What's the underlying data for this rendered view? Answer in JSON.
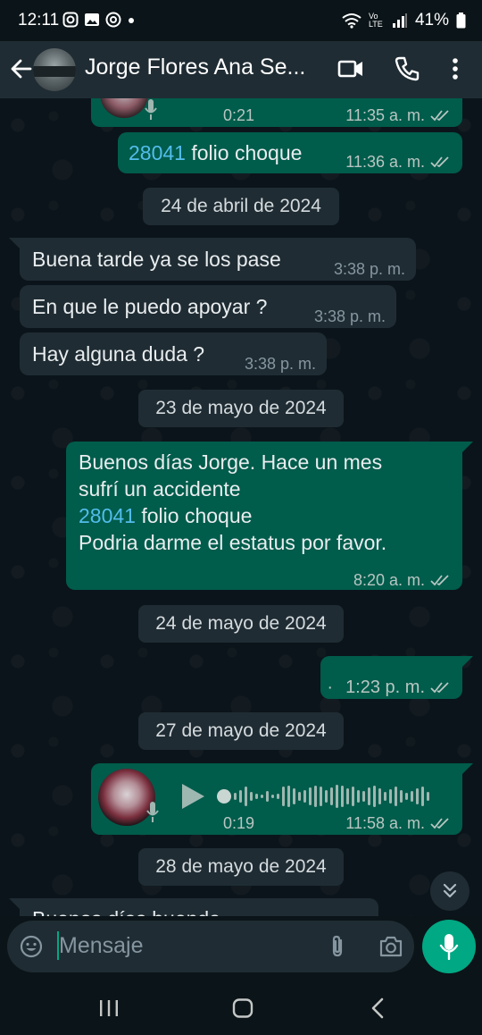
{
  "status_bar": {
    "time": "12:11",
    "battery": "41%",
    "network_label": "Vo LTE",
    "icons": [
      "instagram-icon",
      "gallery-icon",
      "threads-icon",
      "dot-icon",
      "wifi-icon",
      "signal-icon",
      "battery-icon"
    ]
  },
  "header": {
    "title": "Jorge Flores Ana Se...",
    "icons": [
      "back-arrow-icon",
      "video-call-icon",
      "phone-call-icon",
      "more-vert-icon"
    ]
  },
  "messages": {
    "voice_top": {
      "duration": "0:21",
      "time": "11:35 a. m."
    },
    "m1": {
      "link": "28041",
      "text": " folio choque",
      "time": "11:36 a. m."
    },
    "date1": "24 de abril de 2024",
    "m2": {
      "text": "Buena tarde ya se los pase",
      "time": "3:38 p. m."
    },
    "m3": {
      "text": "En que le puedo apoyar ?",
      "time": "3:38 p. m."
    },
    "m4": {
      "text": "Hay alguna duda ?",
      "time": "3:38 p. m."
    },
    "date2": "23 de mayo de 2024",
    "m5": {
      "line1": "Buenos días Jorge. Hace un mes",
      "line2": "sufrí un accidente",
      "link": "28041",
      "line3_rest": " folio choque",
      "line4": "Podria darme el estatus por favor.",
      "time": "8:20 a. m."
    },
    "date3": "24 de mayo de 2024",
    "m6": {
      "text": "·",
      "time": "1:23 p. m."
    },
    "date4": "27 de mayo de 2024",
    "voice": {
      "duration": "0:19",
      "time": "11:58 a. m."
    },
    "date5": "28 de mayo de 2024",
    "partial": "Buenos días buenda..."
  },
  "input": {
    "placeholder": "Mensaje"
  },
  "nav": {
    "icons": [
      "recent-apps-icon",
      "home-icon",
      "back-nav-icon"
    ]
  },
  "colors": {
    "outgoing": "#005c4b",
    "incoming": "#1f2c33",
    "link": "#53bdeb",
    "accent": "#00a884"
  }
}
